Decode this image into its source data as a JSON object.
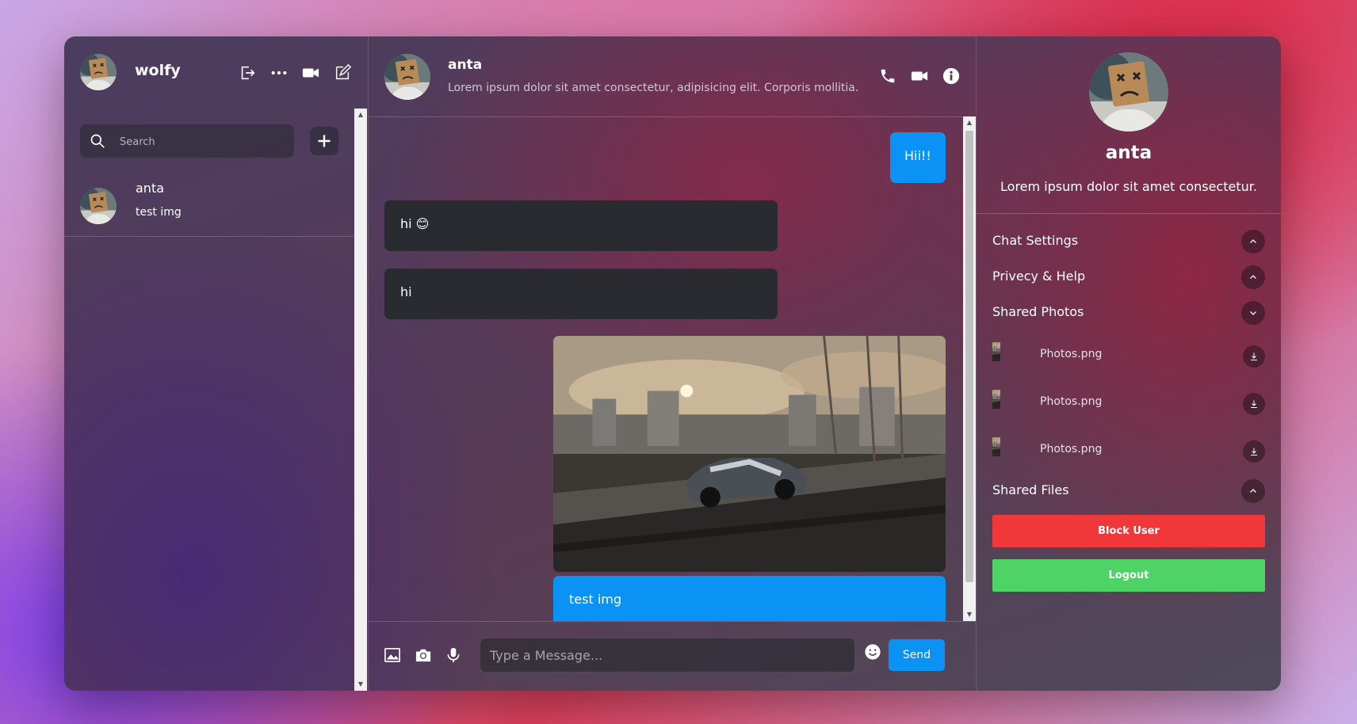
{
  "current_user": {
    "name": "wolfy"
  },
  "left_header": {
    "icons": [
      "logout-icon",
      "more-icon",
      "video-icon",
      "edit-icon"
    ]
  },
  "search": {
    "placeholder": "Search"
  },
  "chat_list": [
    {
      "name": "anta",
      "last_message": "test img"
    }
  ],
  "chat_header": {
    "name": "anta",
    "description": "Lorem ipsum dolor sit amet consectetur, adipisicing elit. Corporis mollitia.",
    "icons": [
      "phone-icon",
      "video-icon",
      "info-icon"
    ]
  },
  "messages": [
    {
      "text": "Hii!!",
      "own": true
    },
    {
      "text": "hi 😊",
      "own": false
    },
    {
      "text": "hi",
      "own": false
    },
    {
      "image": "car-on-bridge-photo",
      "text": "test img",
      "own": true
    }
  ],
  "composer": {
    "placeholder": "Type a Message...",
    "send_label": "Send",
    "icons": [
      "image-icon",
      "camera-icon",
      "mic-icon",
      "emoji-icon"
    ]
  },
  "details": {
    "name": "anta",
    "description": "Lorem ipsum dolor sit amet consectetur.",
    "sections": {
      "chat_settings": "Chat Settings",
      "privacy_help": "Privecy & Help",
      "shared_photos": "Shared Photos",
      "shared_files": "Shared Files"
    },
    "photos": [
      {
        "name": "Photos.png"
      },
      {
        "name": "Photos.png"
      },
      {
        "name": "Photos.png"
      }
    ],
    "block_label": "Block User",
    "logout_label": "Logout"
  },
  "colors": {
    "accent": "#0a93f5",
    "danger": "#f0383a",
    "success": "#4dd366",
    "incoming_bubble": "#2a2b30"
  }
}
